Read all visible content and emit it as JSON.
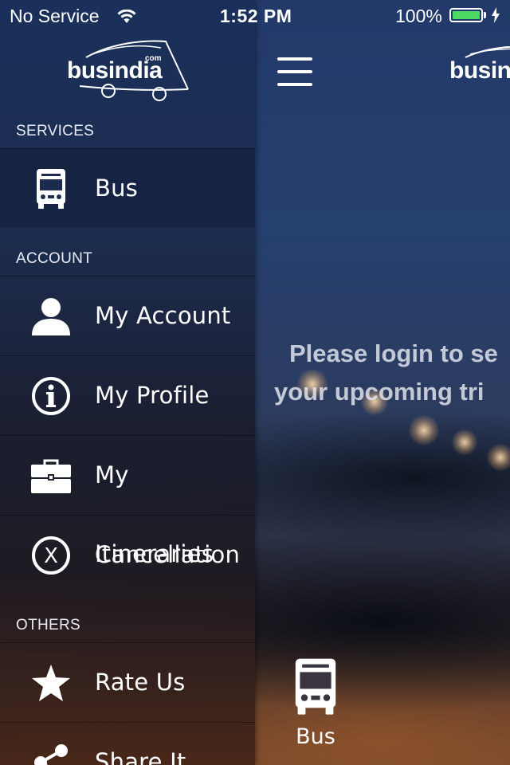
{
  "status_bar": {
    "carrier": "No Service",
    "time": "1:52 PM",
    "battery_percent": "100%",
    "battery_color": "#4cd964"
  },
  "drawer": {
    "logo_text": "busindia",
    "logo_suffix": "com",
    "sections": [
      {
        "title": "SERVICES",
        "items": [
          {
            "label": "Bus",
            "icon": "bus-icon"
          }
        ]
      },
      {
        "title": "ACCOUNT",
        "items": [
          {
            "label": "My Account",
            "icon": "user-icon"
          },
          {
            "label": "My Profile",
            "icon": "info-icon"
          },
          {
            "label": "My Itineraries",
            "icon": "briefcase-icon"
          },
          {
            "label": "Cancellation",
            "icon": "cancel-x-icon"
          }
        ]
      },
      {
        "title": "OTHERS",
        "items": [
          {
            "label": "Rate Us",
            "icon": "star-icon"
          },
          {
            "label": "Share It",
            "icon": "share-icon"
          }
        ]
      }
    ]
  },
  "main": {
    "logo_text": "busindia",
    "login_message_line1": "Please login to se",
    "login_message_line2": "your upcoming tri",
    "tab_bus_label": "Bus"
  }
}
